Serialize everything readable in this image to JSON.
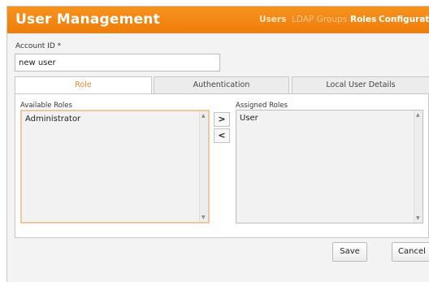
{
  "header": {
    "title": "User Management",
    "nav": [
      {
        "label": "Users"
      },
      {
        "label": "LDAP Groups"
      },
      {
        "label": "Roles"
      },
      {
        "label": "Configuration"
      }
    ]
  },
  "form": {
    "account_label": "Account ID *",
    "account_value": "new user"
  },
  "tabs": [
    {
      "label": "Role",
      "active": true
    },
    {
      "label": "Authentication",
      "active": false
    },
    {
      "label": "Local User Details",
      "active": false
    }
  ],
  "roles": {
    "available_label": "Available Roles",
    "assigned_label": "Assigned Roles",
    "available": [
      "Administrator"
    ],
    "assigned": [
      "User"
    ],
    "move_right": ">",
    "move_left": "<"
  },
  "actions": {
    "save": "Save",
    "cancel": "Cancel"
  },
  "colors": {
    "header": "#f28a16",
    "active_tab_text": "#e8882a"
  }
}
